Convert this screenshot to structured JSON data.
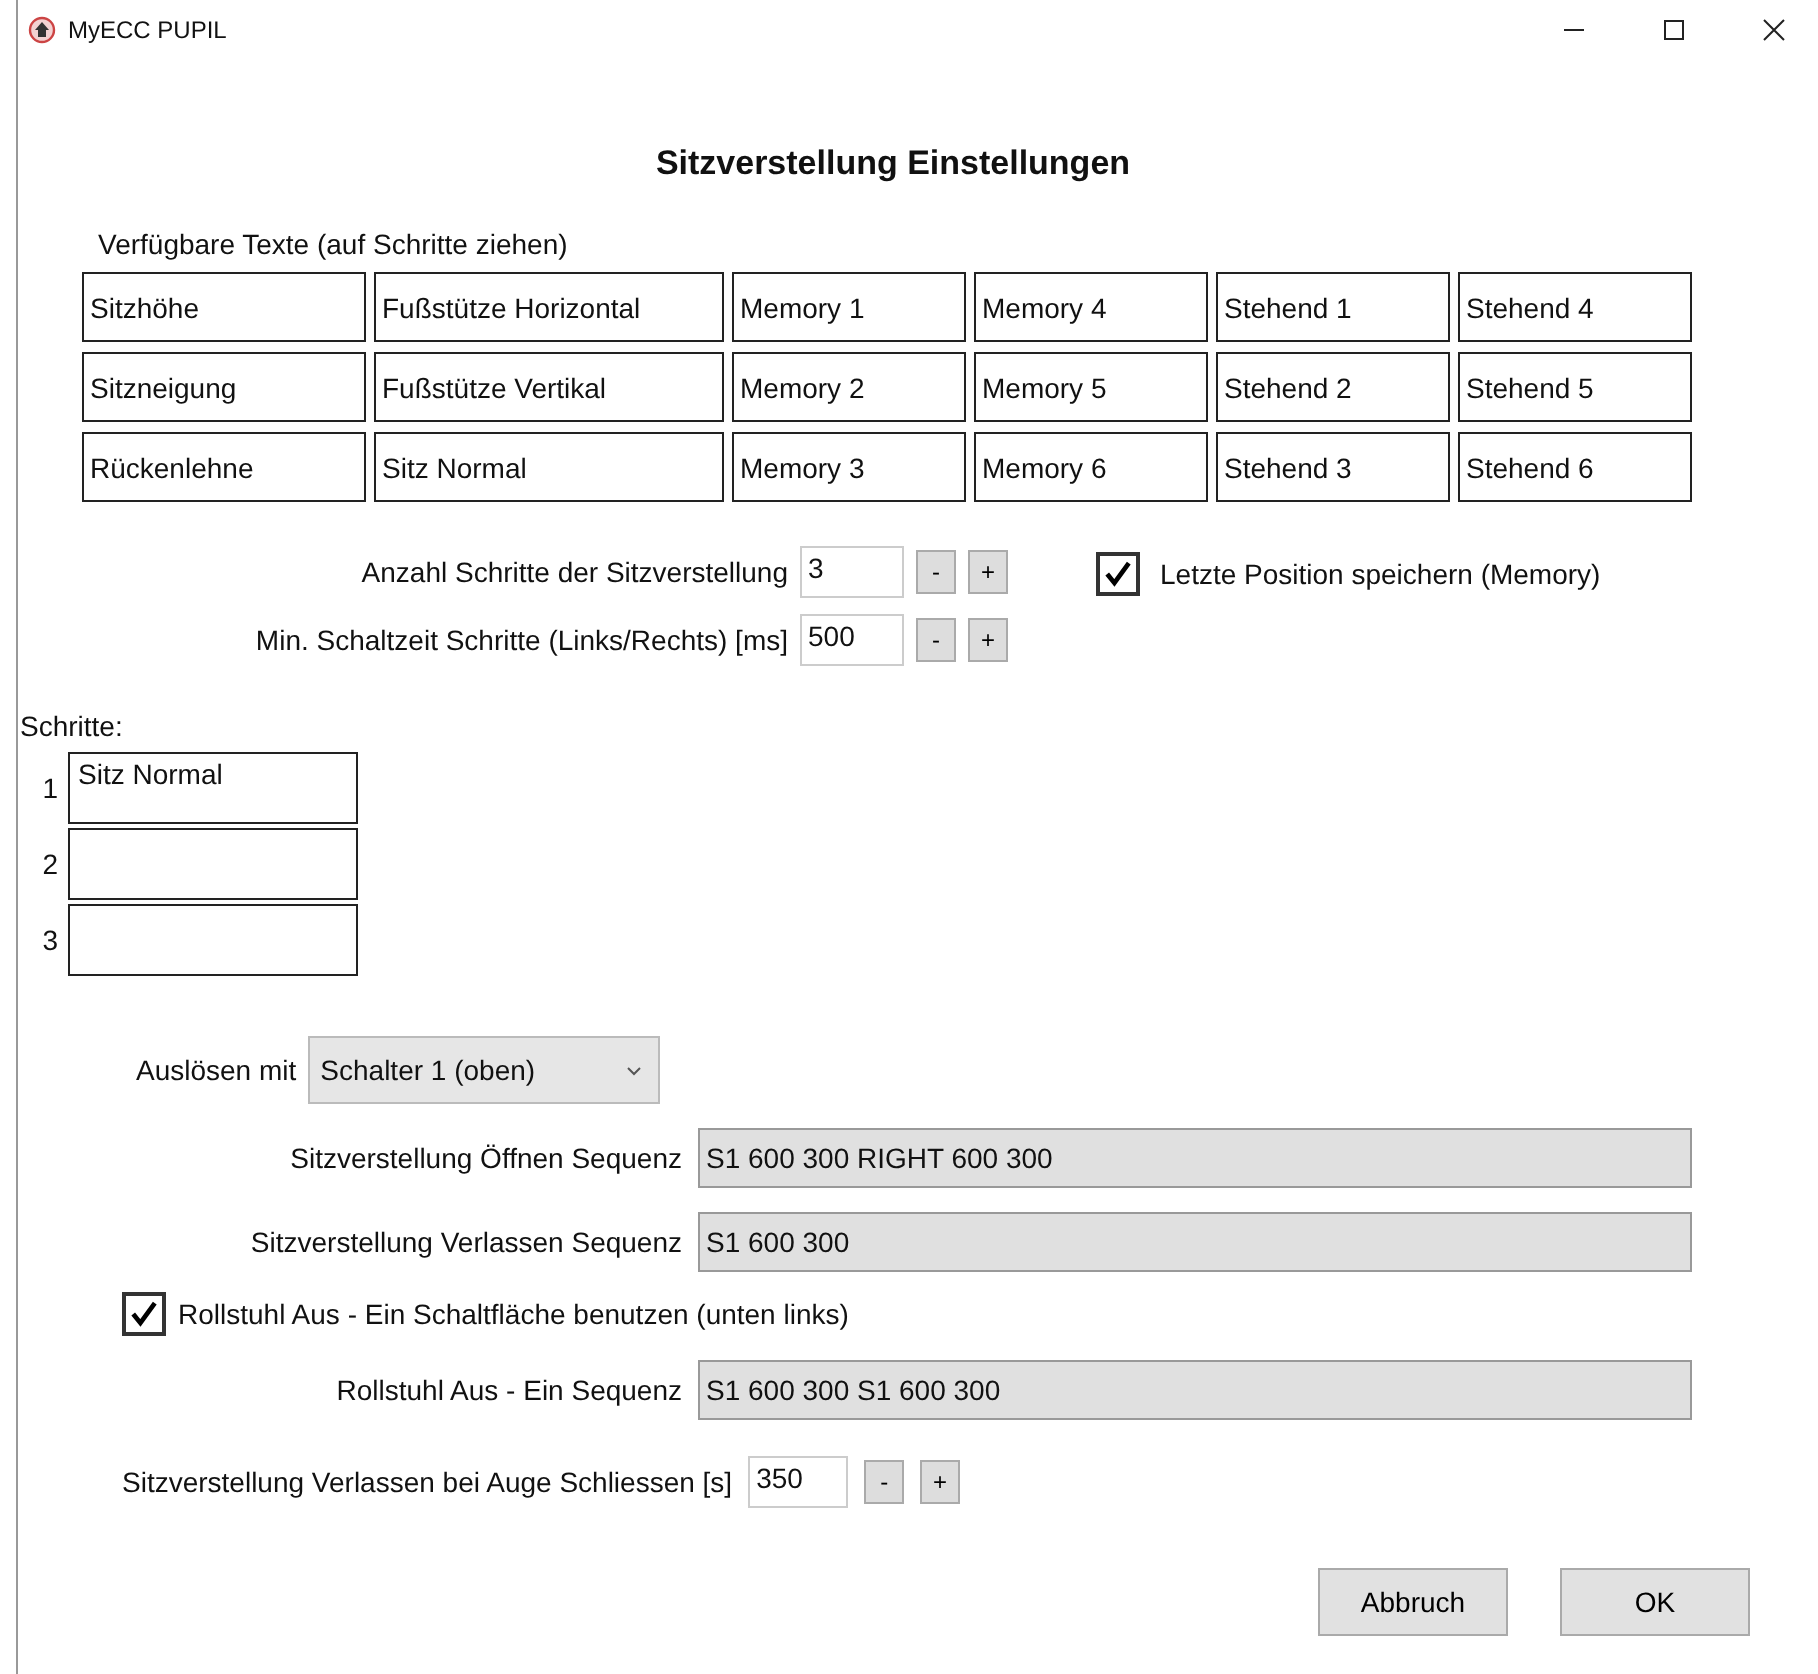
{
  "window": {
    "title": "MyECC PUPIL"
  },
  "heading": "Sitzverstellung Einstellungen",
  "available_label": "Verfügbare Texte (auf Schritte ziehen)",
  "available_texts": [
    [
      "Sitzhöhe",
      "Fußstütze Horizontal",
      "Memory 1",
      "Memory 4",
      "Stehend 1",
      "Stehend 4"
    ],
    [
      "Sitzneigung",
      "Fußstütze Vertikal",
      "Memory 2",
      "Memory 5",
      "Stehend 2",
      "Stehend 5"
    ],
    [
      "Rückenlehne",
      "Sitz Normal",
      "Memory 3",
      "Memory 6",
      "Stehend 3",
      "Stehend 6"
    ]
  ],
  "step_count": {
    "label": "Anzahl Schritte der Sitzverstellung",
    "value": "3",
    "minus": "-",
    "plus": "+"
  },
  "min_switch_time": {
    "label": "Min. Schaltzeit Schritte (Links/Rechts) [ms]",
    "value": "500",
    "minus": "-",
    "plus": "+"
  },
  "save_last_position": {
    "label": "Letzte Position speichern (Memory)",
    "checked": true
  },
  "steps_label": "Schritte:",
  "steps": [
    {
      "number": "1",
      "value": "Sitz Normal"
    },
    {
      "number": "2"
    },
    {
      "number": "3"
    }
  ],
  "trigger": {
    "label": "Auslösen mit",
    "value": "Schalter 1 (oben)"
  },
  "open_sequence": {
    "label": "Sitzverstellung Öffnen Sequenz",
    "value": "S1 600 300 RIGHT 600 300"
  },
  "leave_sequence": {
    "label": "Sitzverstellung Verlassen Sequenz",
    "value": "S1 600 300"
  },
  "wheelchair_button": {
    "label": "Rollstuhl Aus - Ein Schaltfläche benutzen (unten links)",
    "checked": true
  },
  "wheelchair_sequence": {
    "label": "Rollstuhl Aus - Ein Sequenz",
    "value": "S1 600 300 S1 600 300"
  },
  "eye_close": {
    "label": "Sitzverstellung Verlassen bei Auge Schliessen [s]",
    "value": "350",
    "minus": "-",
    "plus": "+"
  },
  "buttons": [
    "Abbruch",
    "OK"
  ]
}
